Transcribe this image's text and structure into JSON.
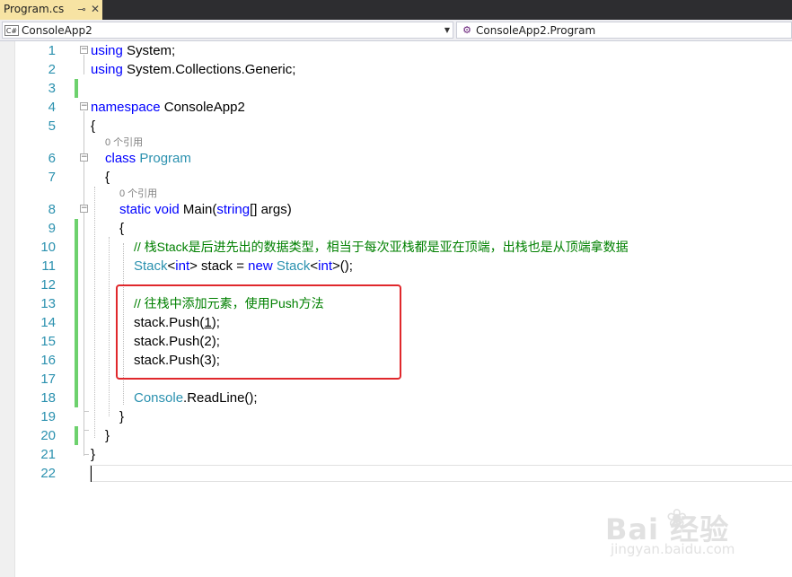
{
  "tab": {
    "title": "Program.cs",
    "pin_icon": "pin-icon",
    "close_icon": "close-icon"
  },
  "nav": {
    "project": "ConsoleApp2",
    "class_path": "ConsoleApp2.Program"
  },
  "editor": {
    "code_lens": [
      "0 个引用",
      "0 个引用"
    ],
    "lines": [
      {
        "n": "1"
      },
      {
        "n": "2"
      },
      {
        "n": "3"
      },
      {
        "n": "4"
      },
      {
        "n": "5"
      },
      {
        "n": "6"
      },
      {
        "n": "7"
      },
      {
        "n": "8"
      },
      {
        "n": "9"
      },
      {
        "n": "10"
      },
      {
        "n": "11"
      },
      {
        "n": "12"
      },
      {
        "n": "13"
      },
      {
        "n": "14"
      },
      {
        "n": "15"
      },
      {
        "n": "16"
      },
      {
        "n": "17"
      },
      {
        "n": "18"
      },
      {
        "n": "19"
      },
      {
        "n": "20"
      },
      {
        "n": "21"
      },
      {
        "n": "22"
      }
    ],
    "tokens": {
      "using": "using",
      "system": " System;",
      "collections": " System.Collections.Generic;",
      "namespace": "namespace",
      "ns_name": " ConsoleApp2",
      "lbrace": "{",
      "rbrace": "}",
      "class": "class",
      "program": " Program",
      "static": "static",
      "void": " void",
      "main": " Main(",
      "string": "string",
      "args": "[] args)",
      "comment1": "// 栈Stack是后进先出的数据类型，相当于每次亚栈都是亚在顶端，出栈也是从顶端拿数据",
      "stack_type": "Stack",
      "lt": "<",
      "int": "int",
      "gt_decl": "> stack = ",
      "new": "new",
      "stack_type2": " Stack",
      "gt_end": ">();",
      "comment2": "// 往栈中添加元素，使用Push方法",
      "push_open": "stack.Push(",
      "one": "1",
      "push_close": ");",
      "push2": "stack.Push(2);",
      "push3": "stack.Push(3);",
      "console": "Console",
      "readline": ".ReadLine();"
    }
  },
  "watermark": {
    "brand": "Bai  经验",
    "url": "jingyan.baidu.com"
  },
  "colors": {
    "keyword": "#0000ff",
    "type": "#2b91af",
    "comment": "#008000",
    "line_number": "#2b91af",
    "change_bar": "#6dd16d",
    "highlight_box": "#e0282c",
    "tab_active": "#f7e3a3"
  }
}
